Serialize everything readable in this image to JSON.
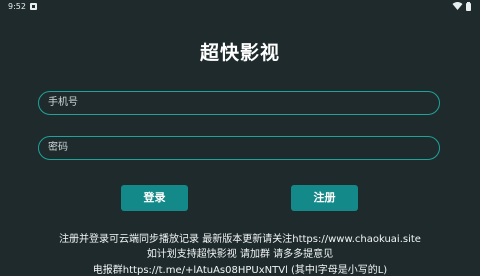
{
  "status_bar": {
    "time": "9:52"
  },
  "app": {
    "title": "超快影视"
  },
  "form": {
    "phone_placeholder": "手机号",
    "password_placeholder": "密码",
    "login_label": "登录",
    "register_label": "注册"
  },
  "notice": {
    "line1": "注册并登录可云端同步播放记录 最新版本更新请关注https://www.chaokuai.site",
    "line2": "如计划支持超快影视 请加群 请多多提意见",
    "line3": "电报群https://t.me/+lAtuAs08HPUxNTVl (其中l字母是小写的L)"
  },
  "icons": {
    "notification": "notification-icon",
    "wifi": "wifi-icon",
    "battery": "battery-icon"
  },
  "colors": {
    "background": "#1e2a2c",
    "accent": "#14898a",
    "input_border": "#1fa39a"
  }
}
